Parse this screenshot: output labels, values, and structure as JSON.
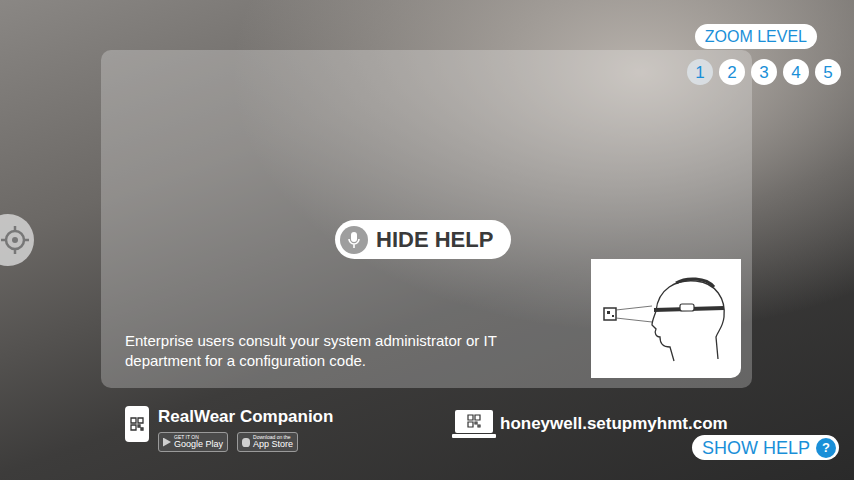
{
  "zoom": {
    "label": "ZOOM LEVEL",
    "levels": [
      {
        "label": "1",
        "selected": true
      },
      {
        "label": "2",
        "selected": false
      },
      {
        "label": "3",
        "selected": false
      },
      {
        "label": "4",
        "selected": false
      },
      {
        "label": "5",
        "selected": false
      }
    ]
  },
  "help_panel": {
    "hide_button": "HIDE HELP",
    "message": "Enterprise users consult your system administrator or IT department for a configuration code."
  },
  "companion": {
    "title": "RealWear Companion",
    "badges": [
      {
        "small": "GET IT ON",
        "label": "Google Play"
      },
      {
        "small": "Download on the",
        "label": "App Store"
      }
    ]
  },
  "setup_url": "honeywell.setupmyhmt.com",
  "show_help": {
    "label": "SHOW HELP",
    "icon": "?"
  }
}
